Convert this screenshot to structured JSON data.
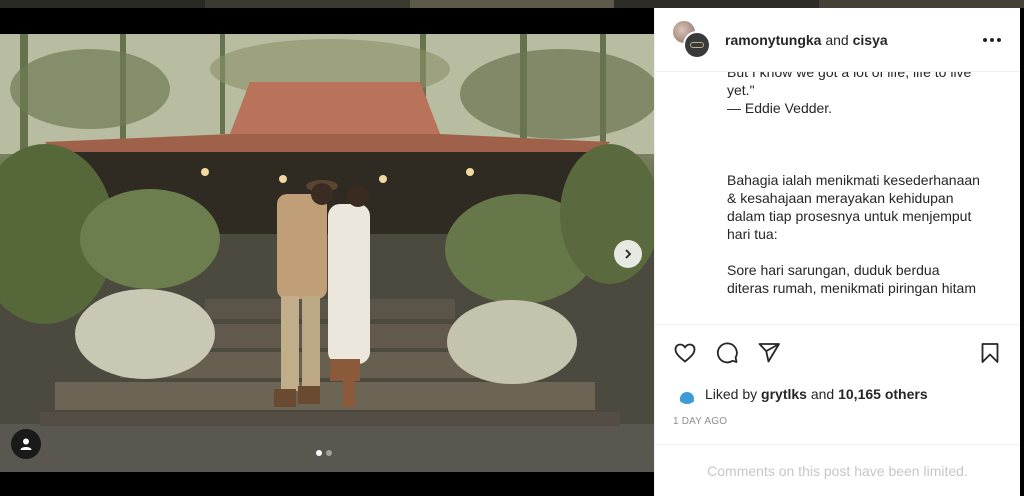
{
  "post": {
    "author": "ramonytungka",
    "connector": "and",
    "coauthor": "cisya"
  },
  "caption_lines": [
    "But I know we got a lot of life, life to live",
    "yet.\"",
    "— Eddie Vedder.",
    "Bahagia ialah menikmati kesederhanaan",
    "& kesahajaan merayakan kehidupan",
    "dalam tiap prosesnya untuk menjemput",
    "hari tua:",
    "Sore hari sarungan, duduk berdua",
    "diteras rumah, menikmati piringan hitam"
  ],
  "likes": {
    "prefix": "Liked by",
    "user": "grytlks",
    "connector": "and",
    "others": "10,165 others"
  },
  "timestamp": "1 DAY AGO",
  "comments_notice": "Comments on this post have been limited.",
  "carousel": {
    "current": 1,
    "total": 2
  },
  "icons": {
    "like": "heart-icon",
    "comment": "comment-icon",
    "share": "paper-plane-icon",
    "save": "bookmark-icon",
    "more": "more-horizontal-icon",
    "next": "chevron-right-icon",
    "tag": "user-tag-icon"
  }
}
